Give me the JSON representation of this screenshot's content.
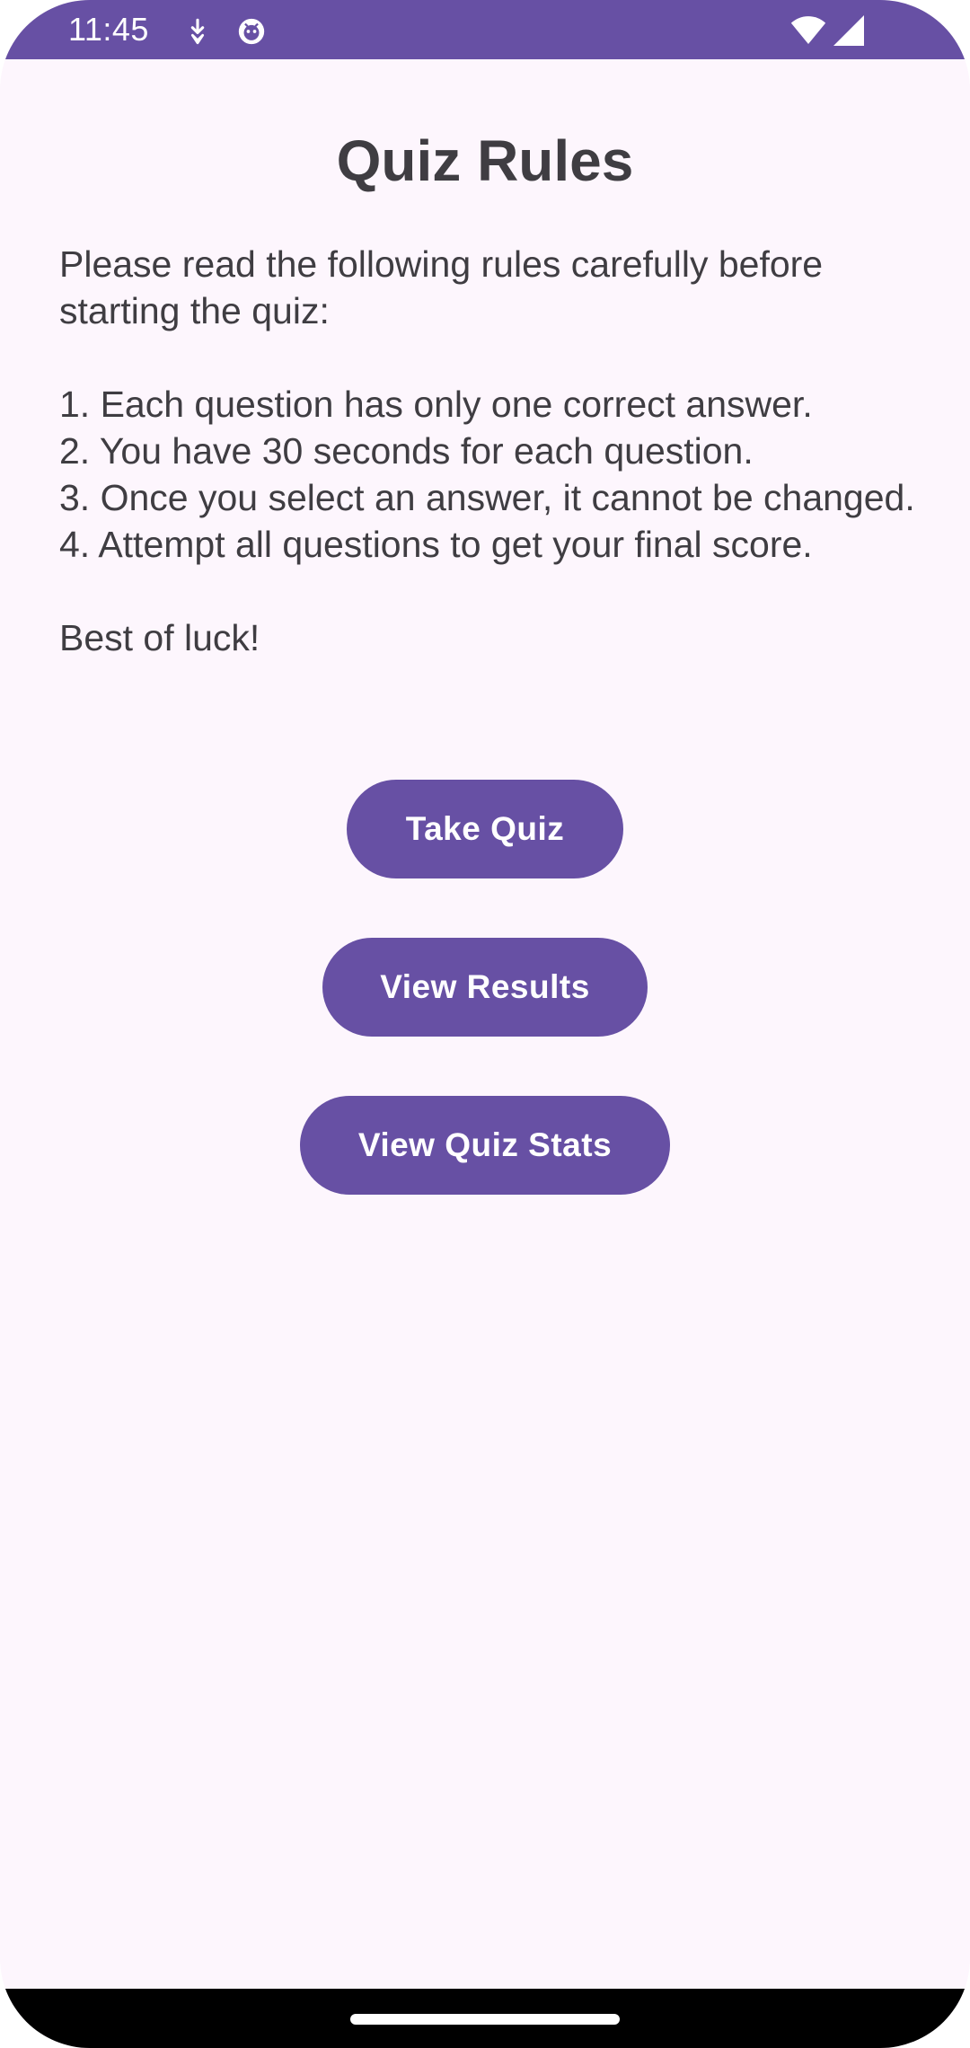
{
  "status_bar": {
    "time": "11:45",
    "icons": [
      "download-icon",
      "app-notification-icon",
      "wifi-icon",
      "cellular-signal-icon"
    ],
    "color": "#6750a4"
  },
  "screen": {
    "title": "Quiz Rules",
    "rules_text": "Please read the following rules carefully before starting the quiz:\n\n1. Each question has only one correct answer.\n2. You have 30 seconds for each question.\n3. Once you select an answer, it cannot be changed.\n4. Attempt all questions to get your final score.\n\nBest of luck!"
  },
  "buttons": {
    "take_quiz": "Take Quiz",
    "view_results": "View Results",
    "view_quiz_stats": "View Quiz Stats"
  },
  "colors": {
    "primary": "#6750a4",
    "background": "#fdf6fd",
    "text": "#3f3d42"
  }
}
